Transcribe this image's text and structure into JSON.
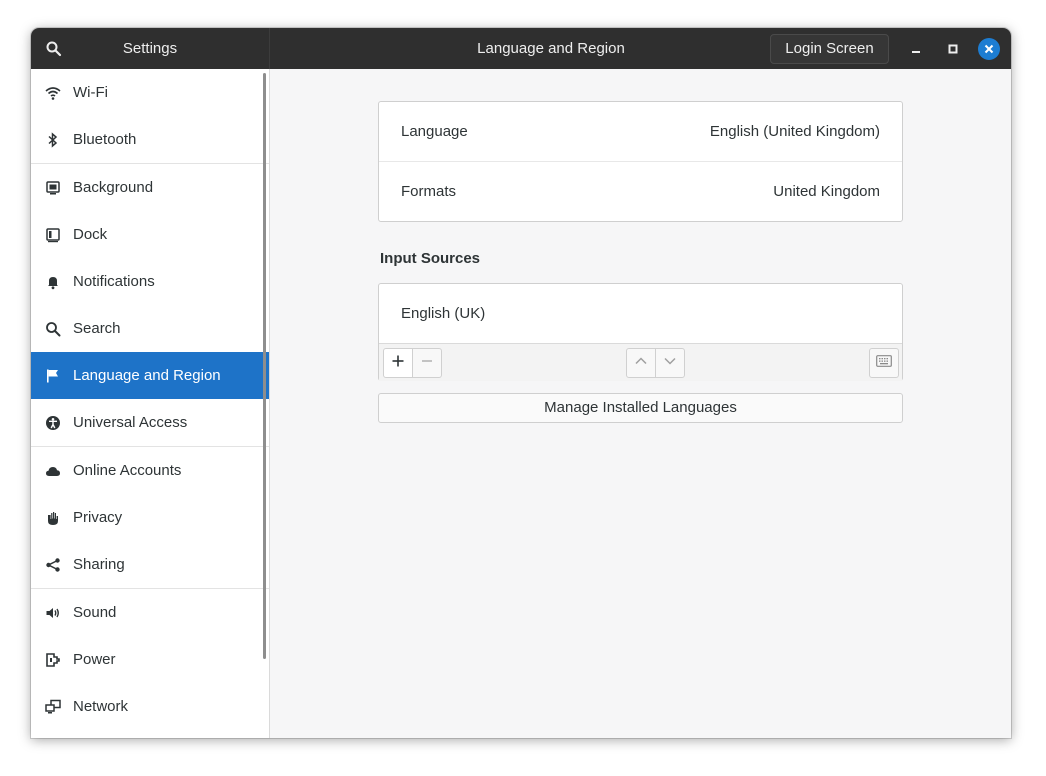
{
  "header": {
    "app_title": "Settings",
    "page_title": "Language and Region",
    "login_screen_label": "Login Screen"
  },
  "sidebar": {
    "items": [
      {
        "label": "Wi-Fi",
        "icon": "wifi-icon"
      },
      {
        "label": "Bluetooth",
        "icon": "bluetooth-icon"
      },
      {
        "label": "Background",
        "icon": "background-icon"
      },
      {
        "label": "Dock",
        "icon": "dock-icon"
      },
      {
        "label": "Notifications",
        "icon": "bell-icon"
      },
      {
        "label": "Search",
        "icon": "search-icon"
      },
      {
        "label": "Language and Region",
        "icon": "flag-icon",
        "active": true
      },
      {
        "label": "Universal Access",
        "icon": "accessibility-icon"
      },
      {
        "label": "Online Accounts",
        "icon": "cloud-icon"
      },
      {
        "label": "Privacy",
        "icon": "hand-icon"
      },
      {
        "label": "Sharing",
        "icon": "share-icon"
      },
      {
        "label": "Sound",
        "icon": "speaker-icon"
      },
      {
        "label": "Power",
        "icon": "power-plug-icon"
      },
      {
        "label": "Network",
        "icon": "network-icon"
      }
    ]
  },
  "main": {
    "language": {
      "label": "Language",
      "value": "English (United Kingdom)"
    },
    "formats": {
      "label": "Formats",
      "value": "United Kingdom"
    },
    "input_sources_title": "Input Sources",
    "input_sources": [
      {
        "label": "English (UK)"
      }
    ],
    "manage_button": "Manage Installed Languages"
  },
  "colors": {
    "accent": "#1e73c8",
    "headerbar": "#2f2f2f",
    "close_button": "#1d7dd2"
  }
}
